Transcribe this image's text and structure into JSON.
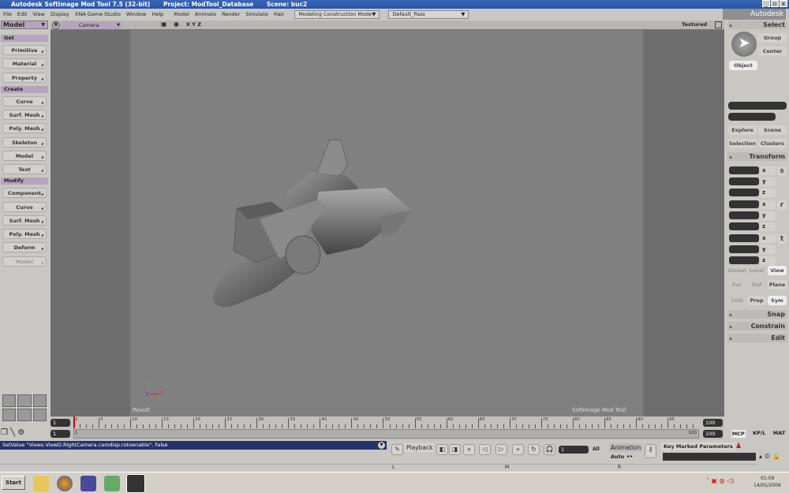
{
  "window": {
    "app_title": "Autodesk Softimage Mod Tool 7.5 (32-bit)",
    "project": "Project: ModTool_Database",
    "scene": "Scene: buc2",
    "brand": "Autodesk Softimage",
    "controls": [
      "_",
      "▫",
      "x"
    ]
  },
  "menu": [
    "File",
    "Edit",
    "View",
    "Display",
    "XNA Game Studio",
    "Window",
    "Help",
    "Model",
    "Animate",
    "Render",
    "Simulate",
    "Hair"
  ],
  "mode_select": "Modeling Construction Mode",
  "pass_select": "Default_Pass",
  "left_panel": {
    "module": "Model",
    "sections": [
      {
        "title": "Get",
        "items": [
          "Primitive",
          "Material",
          "Property"
        ]
      },
      {
        "title": "Create",
        "items": [
          "Curve",
          "Surf. Mesh",
          "Poly. Mesh",
          "Skeleton",
          "Model",
          "Text"
        ]
      },
      {
        "title": "Modify",
        "items": [
          "Component",
          "Curve",
          "Surf. Mesh",
          "Poly. Mesh",
          "Deform",
          "Model"
        ]
      }
    ]
  },
  "viewport": {
    "letter": "B",
    "camera": "Camera",
    "axes": "X Y Z",
    "display_mode": "Textured",
    "label_left": "Result",
    "label_right": "Softimage Mod Tool",
    "gizmo_y": "Y",
    "gizmo_z": "Z",
    "gizmo_x": "X"
  },
  "timeline": {
    "start": 1,
    "end": 100,
    "current": 1,
    "range_start": "1",
    "range_end": "100",
    "range_start_small": "1",
    "range_end_small": "100",
    "start_field": "1",
    "end_field": "100",
    "end_field2": "100"
  },
  "command_line": "SetValue \"Views.ViewD.RightCamera.camdisp.rotoenable\", False",
  "playback": {
    "label": "Playback",
    "frame": "1",
    "all": "All",
    "animation": "Animation",
    "auto": "Auto",
    "key_marked": "Key Marked Parameters",
    "mixer": [
      "L",
      "M",
      "R"
    ]
  },
  "bottom_tabs": [
    "MCP",
    "KP/L",
    "MAT"
  ],
  "right_panel": {
    "select": "Select",
    "group": "Group",
    "center": "Center",
    "object": "Object",
    "explore": "Explore",
    "scene": "Scene",
    "selection": "Selection",
    "clusters": "Clusters",
    "transform": "Transform",
    "s": "s",
    "r": "r",
    "t": "t",
    "axes": [
      "x",
      "y",
      "z"
    ],
    "global": "Global",
    "local": "Local",
    "view": "View",
    "par": "Par",
    "ref": "Ref",
    "plane": "Plane",
    "cog": "COG",
    "prop": "Prop",
    "sym": "Sym",
    "snap": "Snap",
    "constrain": "Constrain",
    "edit": "Edit"
  },
  "taskbar": {
    "start": "Start",
    "time": "01:09",
    "date": "14/05/2009"
  }
}
